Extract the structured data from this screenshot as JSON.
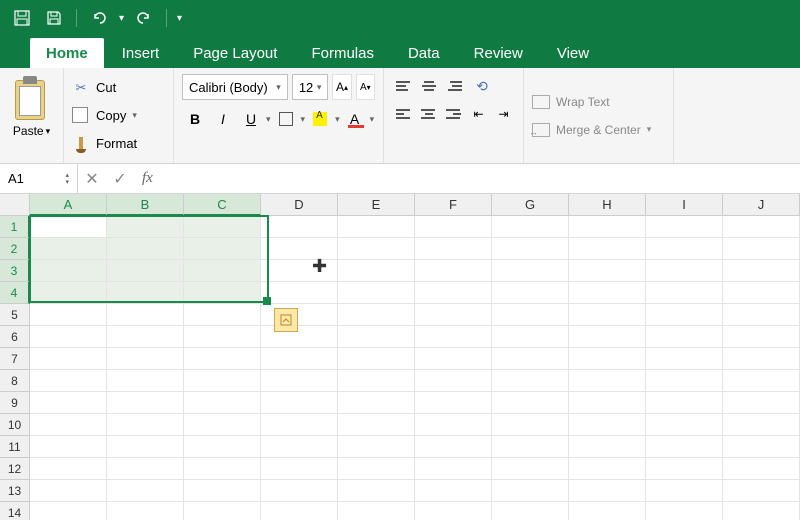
{
  "qat": {
    "undo": "↶",
    "redo": "↷"
  },
  "tabs": [
    "Home",
    "Insert",
    "Page Layout",
    "Formulas",
    "Data",
    "Review",
    "View"
  ],
  "active_tab": "Home",
  "ribbon": {
    "paste": {
      "label": "Paste"
    },
    "clipboard": {
      "cut": "Cut",
      "copy": "Copy",
      "format": "Format"
    },
    "font": {
      "name": "Calibri (Body)",
      "size": "12",
      "bold": "B",
      "italic": "I",
      "underline": "U"
    },
    "wrap": {
      "wrap_text": "Wrap Text",
      "merge_center": "Merge & Center"
    }
  },
  "formula_bar": {
    "name_box": "A1",
    "fx": "fx",
    "value": ""
  },
  "columns": [
    "A",
    "B",
    "C",
    "D",
    "E",
    "F",
    "G",
    "H",
    "I",
    "J"
  ],
  "rows": [
    "1",
    "2",
    "3",
    "4",
    "5",
    "6",
    "7",
    "8",
    "9",
    "10",
    "11",
    "12",
    "13",
    "14"
  ],
  "selection": {
    "cols_sel": [
      "A",
      "B",
      "C"
    ],
    "rows_sel": [
      "1",
      "2",
      "3",
      "4"
    ],
    "ref": "A1:C4"
  }
}
